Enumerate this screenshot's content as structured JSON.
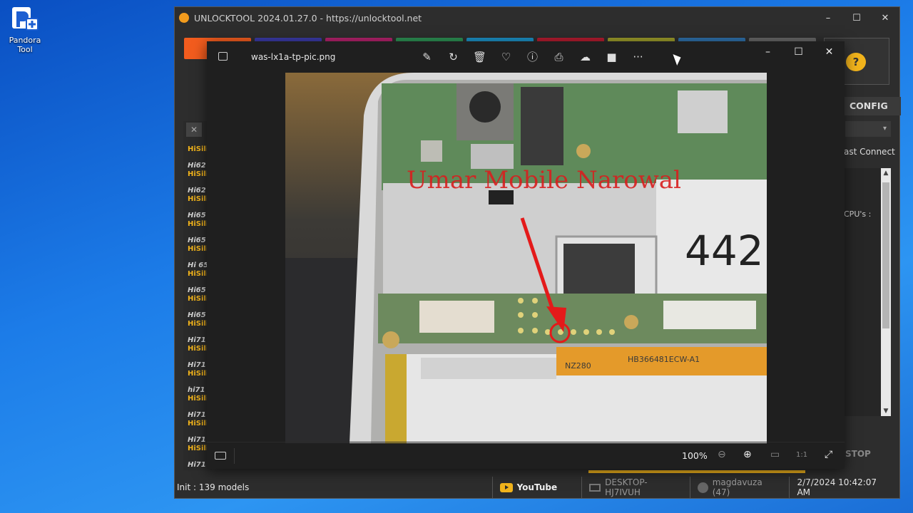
{
  "desktop": {
    "icon_label": "Pandora Tool"
  },
  "unlocktool": {
    "title": "UNLOCKTOOL 2024.01.27.0 - https://unlocktool.net",
    "window_controls": {
      "minimize": "–",
      "maximize": "☐",
      "close": "✕"
    },
    "tile_colors": [
      "#f25c1e",
      "#3a3aa6",
      "#b2226b",
      "#2c8f52",
      "#1b8fc4",
      "#b31c2f",
      "#9a9a2a",
      "#2e6fa8",
      "#666666"
    ],
    "list_close": "✕",
    "models": [
      {
        "name": "",
        "brand": "HiSili"
      },
      {
        "name": "Hi62",
        "brand": "HiSili"
      },
      {
        "name": "Hi62",
        "brand": "HiSili"
      },
      {
        "name": "Hi65",
        "brand": "HiSili"
      },
      {
        "name": "Hi65",
        "brand": "HiSili"
      },
      {
        "name": "Hi 65",
        "brand": "HiSili"
      },
      {
        "name": "Hi65",
        "brand": "HiSili"
      },
      {
        "name": "Hi65",
        "brand": "HiSili"
      },
      {
        "name": "Hi71",
        "brand": "HiSili"
      },
      {
        "name": "Hi71",
        "brand": "HiSili"
      },
      {
        "name": "hi71",
        "brand": "HiSili"
      },
      {
        "name": "Hi71",
        "brand": "HiSili"
      },
      {
        "name": "Hi71",
        "brand": "HiSili"
      },
      {
        "name": "Hi71",
        "brand": ""
      }
    ],
    "help_icon": "?",
    "config_label": "CONFIG",
    "dropdown_arrow": "▾",
    "fast_connect": "ast Connect",
    "cpus_label": "CPU's :",
    "stop_label": "STOP",
    "status": {
      "init": "Init : 139 models",
      "youtube": "YouTube",
      "computer": "DESKTOP-HJ7IVUH",
      "user": "magdavuza (47)",
      "datetime": "2/7/2024 10:42:07 AM"
    }
  },
  "viewer": {
    "filename": "was-lx1a-tp-pic.png",
    "toolbar_icons": [
      "edit-icon",
      "rotate-icon",
      "delete-icon",
      "favorite-icon",
      "info-icon",
      "print-icon",
      "onedrive-icon",
      "clipchamp-icon",
      "more-icon"
    ],
    "toolbar_glyphs": [
      "✎",
      "↻",
      "🗑",
      "♡",
      "ⓘ",
      "⎙",
      "☁",
      "■",
      "···"
    ],
    "window_controls": {
      "minimize": "–",
      "maximize": "☐",
      "close": "✕"
    },
    "photo_watermark": "Umar Mobile Narowal",
    "zoom": "100%",
    "zoom_out": "⊖",
    "zoom_in": "⊕",
    "fit": "▭",
    "actual_size": "1:1",
    "fullscreen": "⤢"
  }
}
